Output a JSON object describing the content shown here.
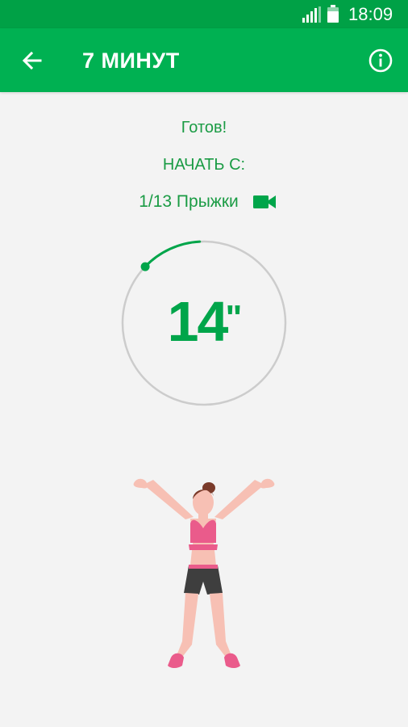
{
  "status_bar": {
    "time": "18:09"
  },
  "app_bar": {
    "title": "7 МИНУТ",
    "back_icon": "arrow-left-icon",
    "info_icon": "info-circle-icon"
  },
  "workout": {
    "status": "Готов!",
    "start_label": "НАЧАТЬ С:",
    "exercise": "1/13 Прыжки",
    "video_icon": "video-camera-icon"
  },
  "timer": {
    "seconds": "14",
    "unit_mark": "\"",
    "progress_fraction": 0.12
  },
  "colors": {
    "status_bar": "#00a146",
    "app_bar": "#00b152",
    "accent": "#00a54a",
    "ring": "#cccccc",
    "background": "#f3f3f3"
  }
}
